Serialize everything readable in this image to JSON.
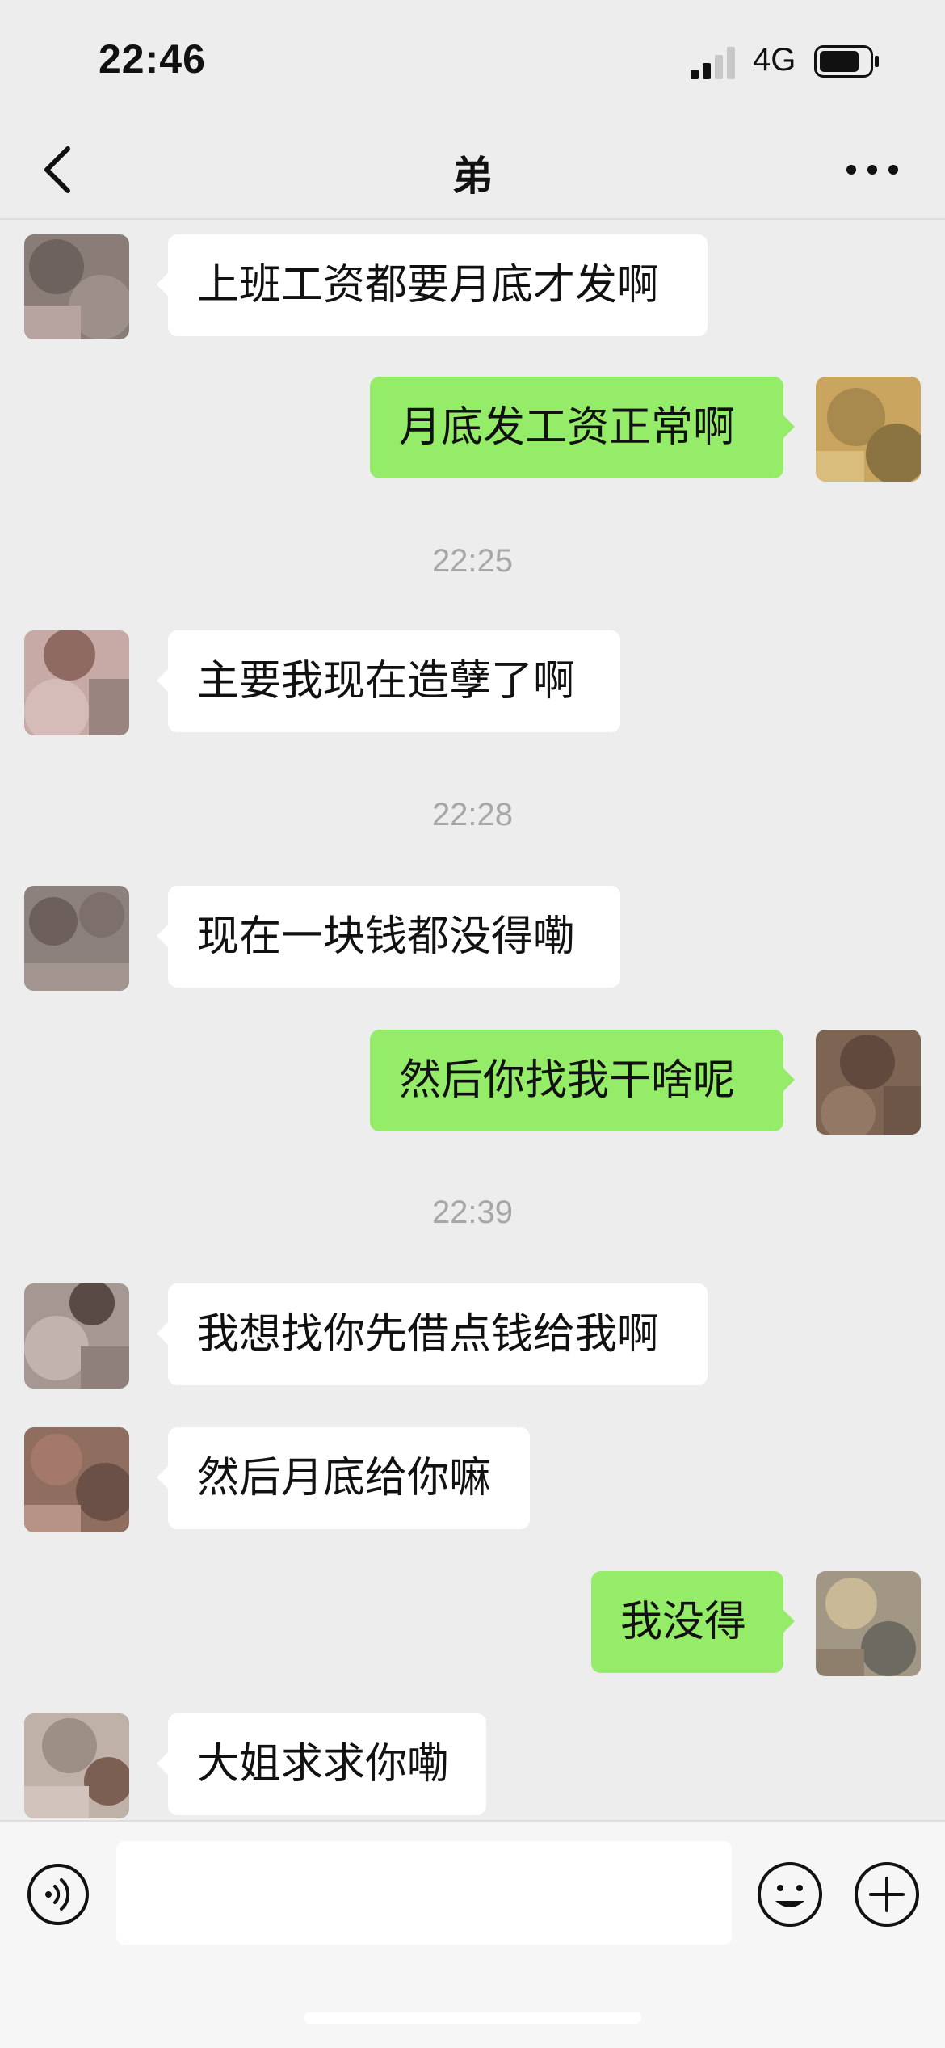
{
  "status_bar": {
    "time": "22:46",
    "network": "4G",
    "battery_level": 0.8
  },
  "nav": {
    "title": "弟",
    "back_icon": "chevron-left-icon",
    "more_icon": "more-dots-icon"
  },
  "messages": [
    {
      "side": "left",
      "text": "上班工资都要月底才发啊"
    },
    {
      "side": "right",
      "text": "月底发工资正常啊"
    },
    {
      "type": "time",
      "text": "22:25"
    },
    {
      "side": "left",
      "text": "主要我现在造孽了啊"
    },
    {
      "type": "time",
      "text": "22:28"
    },
    {
      "side": "left",
      "text": "现在一块钱都没得嘞"
    },
    {
      "side": "right",
      "text": "然后你找我干啥呢"
    },
    {
      "type": "time",
      "text": "22:39"
    },
    {
      "side": "left",
      "text": "我想找你先借点钱给我啊"
    },
    {
      "side": "left",
      "text": "然后月底给你嘛"
    },
    {
      "side": "right",
      "text": "我没得"
    },
    {
      "side": "left",
      "text": "大姐求求你嘞"
    }
  ],
  "input_bar": {
    "value": "",
    "voice_icon": "voice-icon",
    "emoji_icon": "emoji-icon",
    "plus_icon": "plus-icon"
  },
  "colors": {
    "background": "#ededed",
    "my_bubble": "#95ec69",
    "other_bubble": "#ffffff",
    "timestamp": "#a7a7a7"
  }
}
